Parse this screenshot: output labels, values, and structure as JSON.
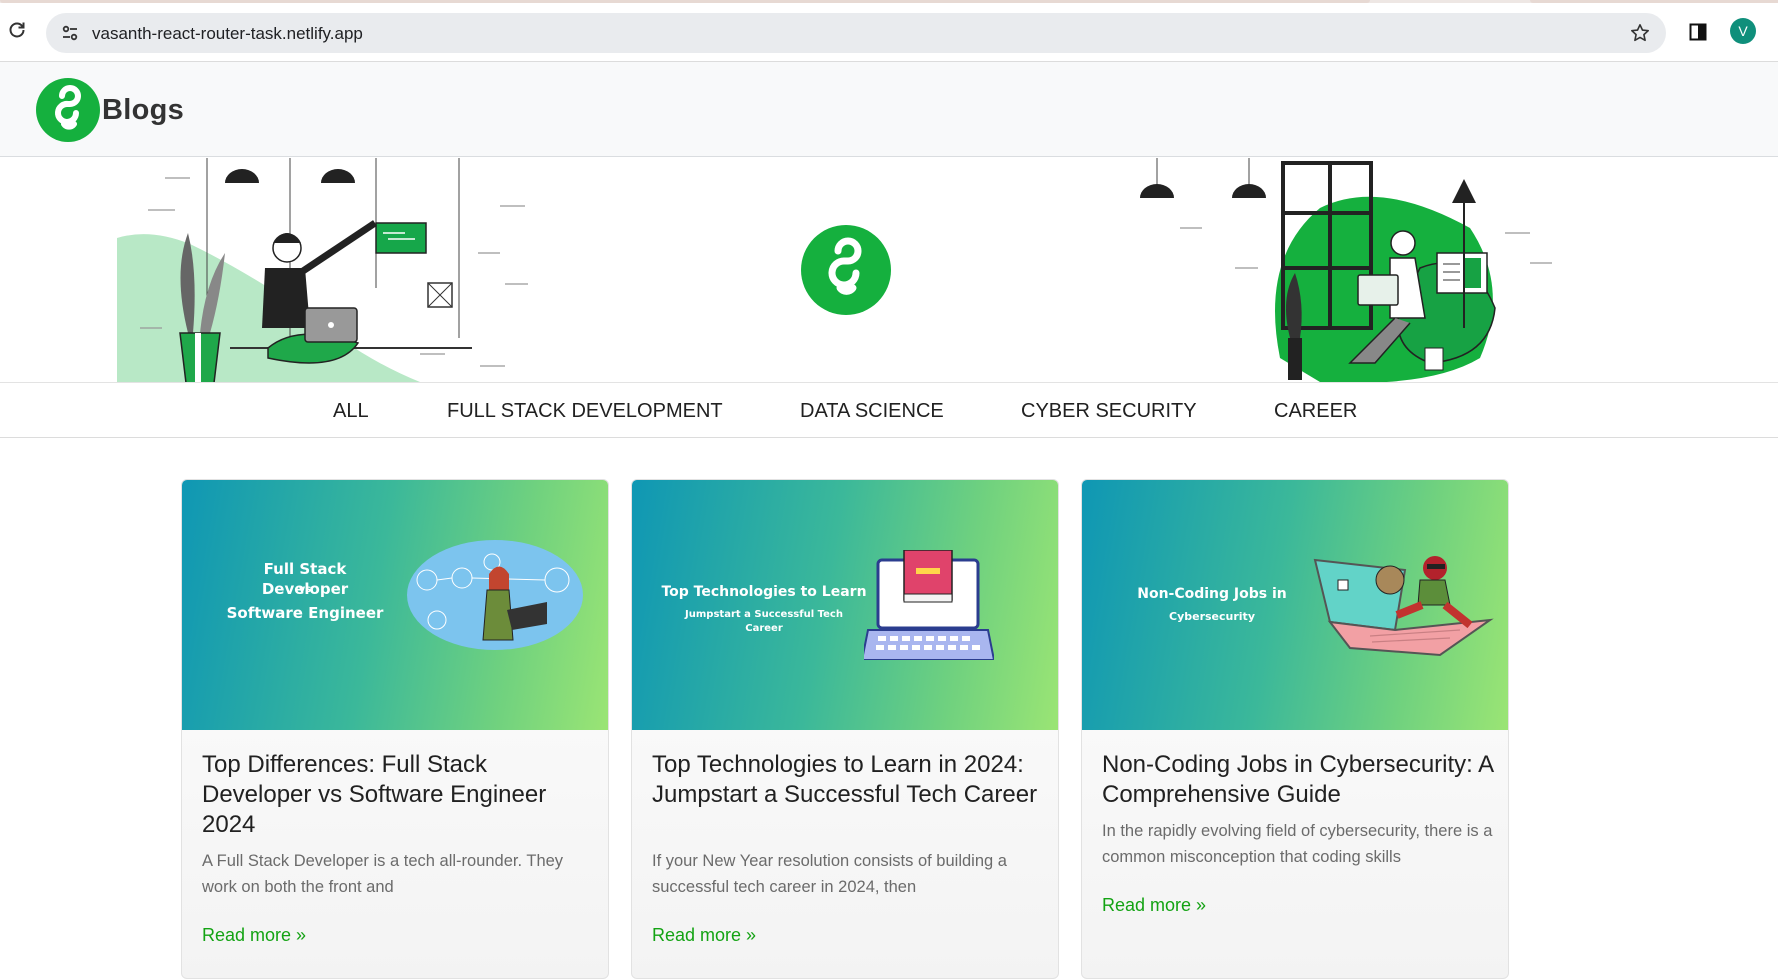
{
  "browser": {
    "url": "vasanth-react-router-task.netlify.app",
    "profile_initial": "V"
  },
  "header": {
    "brand": "Blogs"
  },
  "nav": {
    "categories": [
      "ALL",
      "FULL STACK DEVELOPMENT",
      "DATA SCIENCE",
      "CYBER SECURITY",
      "CAREER"
    ]
  },
  "posts": [
    {
      "banner_title": "Full Stack Developer",
      "banner_vs": "vs",
      "banner_subtitle": "Software Engineer",
      "title": "Top Differences: Full Stack Developer vs Software Engineer 2024",
      "excerpt": "A Full Stack Developer is a tech all-rounder. They work on both the front and",
      "link": "Read more »"
    },
    {
      "banner_title": "Top Technologies to Learn",
      "banner_subtitle": "Jumpstart a Successful Tech Career",
      "title": "Top Technologies to Learn in 2024: Jumpstart a Successful Tech Career",
      "excerpt": "If your New Year resolution consists of building a successful tech career in 2024, then",
      "link": "Read more »"
    },
    {
      "banner_title": "Non-Coding Jobs in",
      "banner_subtitle": "Cybersecurity",
      "title": "Non-Coding Jobs in Cybersecurity: A Comprehensive Guide",
      "excerpt": "In the rapidly evolving field of cybersecurity, there is a common misconception that coding skills",
      "link": "Read more »"
    }
  ],
  "colors": {
    "brand_green": "#15b03e",
    "link_green": "#13a313",
    "banner_start": "#0f97b4",
    "banner_end": "#9be574"
  }
}
